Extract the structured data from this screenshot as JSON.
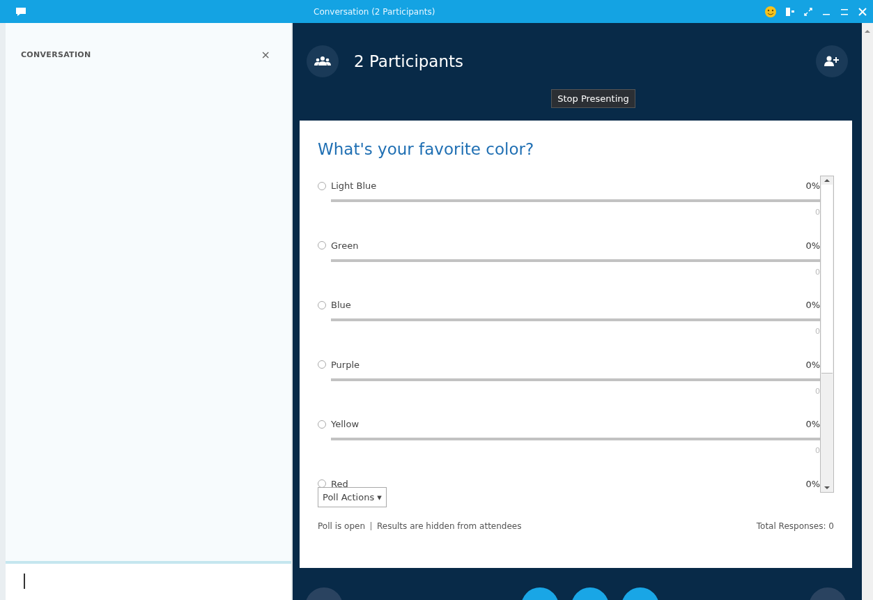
{
  "window": {
    "title": "Conversation (2 Participants)"
  },
  "sidebar": {
    "title": "CONVERSATION",
    "close": "×"
  },
  "header": {
    "title": "2 Participants",
    "tooltip": "Stop Presenting"
  },
  "poll": {
    "question": "What's your favorite color?",
    "options": [
      {
        "label": "Light Blue",
        "percent": "0%",
        "count": "0",
        "level": 0,
        "selected": false
      },
      {
        "label": "Green",
        "percent": "0%",
        "count": "0",
        "level": 0,
        "selected": false
      },
      {
        "label": "Blue",
        "percent": "0%",
        "count": "0",
        "level": 0,
        "selected": false
      },
      {
        "label": "Purple",
        "percent": "0%",
        "count": "0",
        "level": 0,
        "selected": false
      },
      {
        "label": "Yellow",
        "percent": "0%",
        "count": "0",
        "level": 0,
        "selected": false
      },
      {
        "label": "Red",
        "percent": "0%",
        "selected": false
      }
    ],
    "actions": "Poll Actions ▾",
    "status": "Poll is open",
    "results_note": "Results are hidden from attendees",
    "total": "Total Responses: 0"
  }
}
